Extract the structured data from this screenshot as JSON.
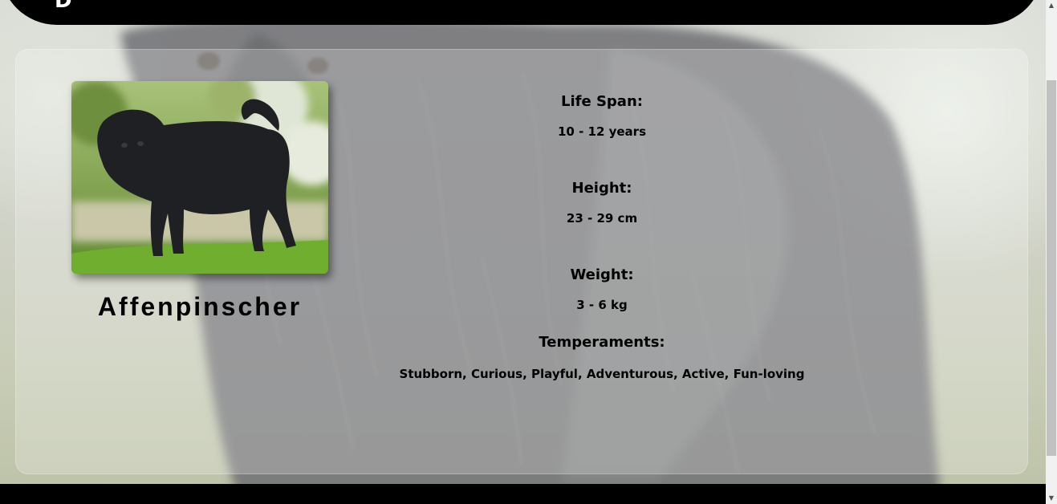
{
  "header": {
    "logo_text": "D"
  },
  "breed": {
    "name": "Affenpinscher",
    "image_alt": "Affenpinscher"
  },
  "details": {
    "life_span_label": "Life Span:",
    "life_span_value": "10 - 12 years",
    "height_label": "Height:",
    "height_value": "23 - 29 cm",
    "weight_label": "Weight:",
    "weight_value": "3 - 6 kg",
    "temperaments_label": "Temperaments:",
    "temperaments_value": "Stubborn, Curious, Playful, Adventurous, Active, Fun-loving"
  },
  "colors": {
    "header_bg": "#000000",
    "footer_bg": "#000000",
    "text": "#000000"
  }
}
